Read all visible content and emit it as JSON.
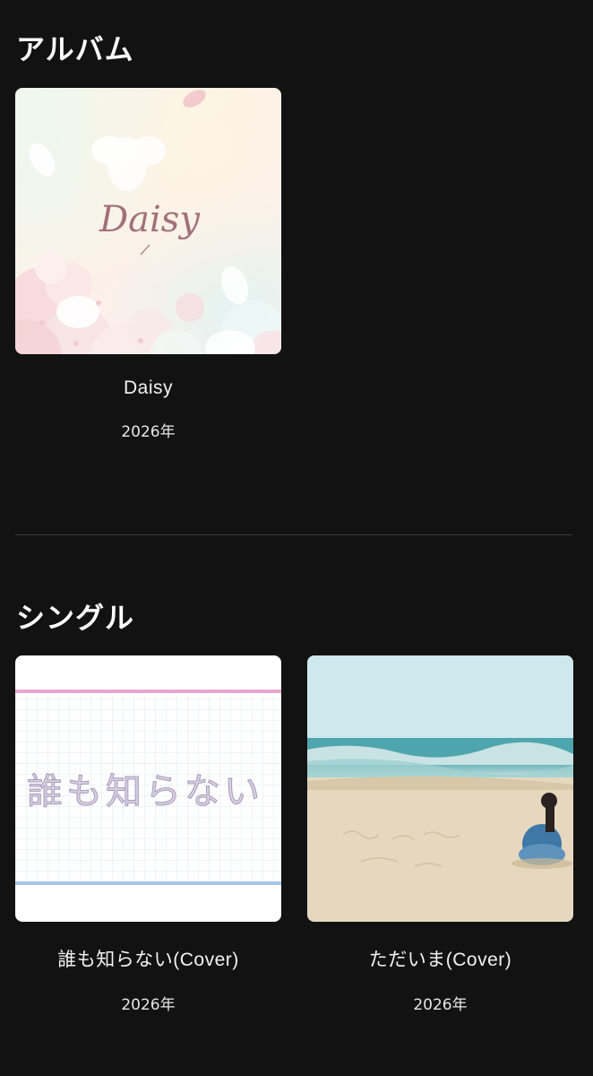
{
  "sections": {
    "album": {
      "title": "アルバム",
      "items": [
        {
          "cover_text": "Daisy",
          "title": "Daisy",
          "year": "2026年"
        }
      ]
    },
    "single": {
      "title": "シングル",
      "items": [
        {
          "cover_text": "誰も知らない",
          "title": "誰も知らない(Cover)",
          "year": "2026年"
        },
        {
          "title": "ただいま(Cover)",
          "year": "2026年"
        }
      ]
    }
  },
  "colors": {
    "background": "#121212",
    "divider": "#3a3a3a",
    "text": "#ffffff"
  }
}
